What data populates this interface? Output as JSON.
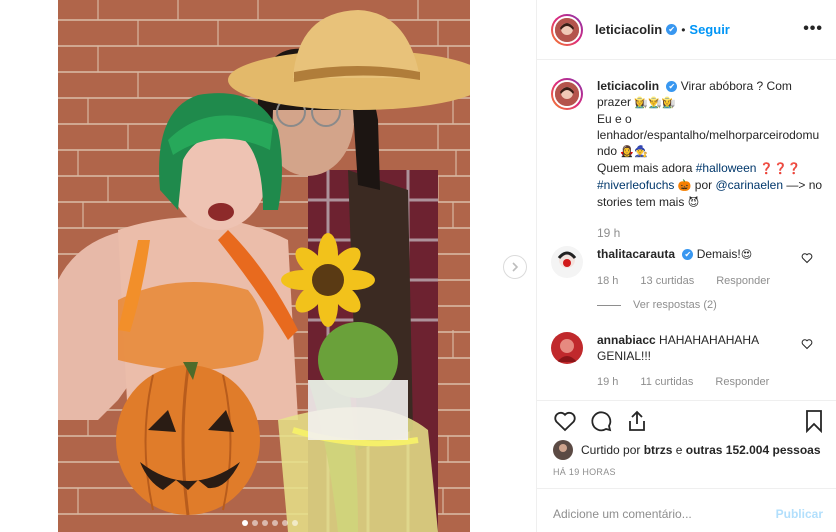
{
  "post": {
    "username": "leticiacolin",
    "verified_badge": "✔",
    "dot": "•",
    "follow_label": "Seguir",
    "more_label": "•••",
    "media_dots": 6,
    "active_dot": 0
  },
  "caption": {
    "username": "leticiacolin",
    "line1": "Virar abóbora ? Com prazer",
    "line1_emoji": "👩‍🌾👨‍🌾👩‍🌾",
    "line2": "Eu e o lenhador/espantalho/melhorparceirodomundo",
    "line2_emoji": "🧛‍♀️🧙",
    "line3_text": "Quem mais adora",
    "hashtag1": "#halloween",
    "line3_emoji": "❓❓❓",
    "hashtag2": "#niverleofuchs",
    "pumpkin_emoji": "🎃",
    "por": "por",
    "mention": "@carinaelen",
    "tail": "—> no stories tem mais",
    "devil_emoji": "😈",
    "time": "19 h"
  },
  "comments": [
    {
      "username": "thalitacarauta",
      "verified_badge": "✔",
      "text": "Demais!",
      "emoji": "😍",
      "time": "18 h",
      "likes": "13 curtidas",
      "reply": "Responder",
      "view_replies": "Ver respostas (2)"
    },
    {
      "username": "annabiacc",
      "text": "HAHAHAHAHAHA GENIAL!!!",
      "time": "19 h",
      "likes": "11 curtidas",
      "reply": "Responder"
    }
  ],
  "likes": {
    "prefix": "Curtido por",
    "user": "btrzs",
    "middle": "e",
    "others": "outras 152.004 pessoas"
  },
  "timestamp": "HÁ 19 HORAS",
  "add_comment": {
    "placeholder": "Adicione um comentário...",
    "publish": "Publicar"
  },
  "colors": {
    "link": "#00376b",
    "follow": "#0095f6",
    "verified": "#3897f0",
    "muted": "#8e8e8e"
  }
}
